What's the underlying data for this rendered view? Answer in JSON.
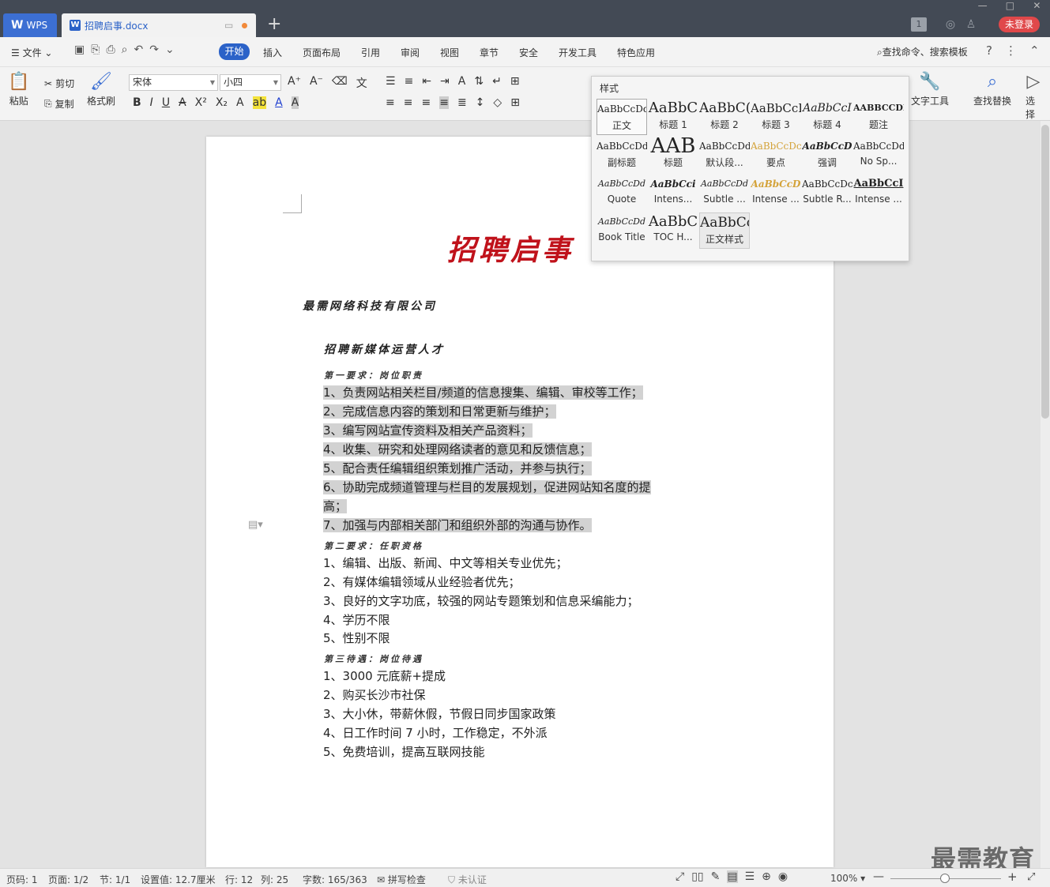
{
  "titlebar": {
    "app_tab": "WPS",
    "doc_tab": "招聘启事.docx",
    "new_tab": "+",
    "login": "未登录",
    "window_buttons": [
      "—",
      "□",
      "✕"
    ],
    "badge": "1"
  },
  "menubar": {
    "file": "文件",
    "items": [
      "开始",
      "插入",
      "页面布局",
      "引用",
      "审阅",
      "视图",
      "章节",
      "安全",
      "开发工具",
      "特色应用"
    ],
    "search": "查找命令、搜索模板"
  },
  "ribbon": {
    "paste": "粘贴",
    "cut": "剪切",
    "copy": "复制",
    "format_painter": "格式刷",
    "font_name": "宋体",
    "font_size": "小四",
    "text_tools": "文字工具",
    "find_replace": "查找替换",
    "select": "选择"
  },
  "style_popup": {
    "title": "样式",
    "styles": [
      {
        "preview": "AaBbCcDd",
        "name": "正文"
      },
      {
        "preview": "AaBbC",
        "name": "标题 1"
      },
      {
        "preview": "AaBbC(",
        "name": "标题 2"
      },
      {
        "preview": "AaBbCcI",
        "name": "标题 3"
      },
      {
        "preview": "AaBbCcI",
        "name": "标题 4"
      },
      {
        "preview": "AABBCCDD",
        "name": "题注"
      },
      {
        "preview": "AaBbCcDd",
        "name": "副标题"
      },
      {
        "preview": "AAB",
        "name": "标题"
      },
      {
        "preview": "AaBbCcDd",
        "name": "默认段..."
      },
      {
        "preview": "AaBbCcDc",
        "name": "要点"
      },
      {
        "preview": "AaBbCcD",
        "name": "强调"
      },
      {
        "preview": "AaBbCcDd",
        "name": "No Sp..."
      },
      {
        "preview": "AaBbCcDd",
        "name": "Quote"
      },
      {
        "preview": "AaBbCci",
        "name": "Intens..."
      },
      {
        "preview": "AaBbCcDd",
        "name": "Subtle ..."
      },
      {
        "preview": "AaBbCcD",
        "name": "Intense ..."
      },
      {
        "preview": "AaBbCcDc",
        "name": "Subtle R..."
      },
      {
        "preview": "AaBbCcI",
        "name": "Intense ..."
      },
      {
        "preview": "AaBbCcDd",
        "name": "Book Title"
      },
      {
        "preview": "AaBbC",
        "name": "TOC H..."
      },
      {
        "preview": "AaBbCc",
        "name": "正文样式"
      }
    ]
  },
  "document": {
    "title": "招聘启事",
    "company": "最需网络科技有限公司",
    "job_title": "招聘新媒体运营人才",
    "section1": "第一要求：岗位职责",
    "section1_items": [
      "1、负责网站相关栏目/频道的信息搜集、编辑、审校等工作；",
      "2、完成信息内容的策划和日常更新与维护；",
      "3、编写网站宣传资料及相关产品资料；",
      "4、收集、研究和处理网络读者的意见和反馈信息；",
      "5、配合责任编辑组织策划推广活动，并参与执行；",
      "6、协助完成频道管理与栏目的发展规划，促进网站知名度的提",
      "高；",
      "7、加强与内部相关部门和组织外部的沟通与协作。"
    ],
    "section2": "第二要求：任职资格",
    "section2_items": [
      "1、编辑、出版、新闻、中文等相关专业优先；",
      "2、有媒体编辑领域从业经验者优先；",
      "3、良好的文字功底，较强的网站专题策划和信息采编能力；",
      "4、学历不限",
      "5、性别不限"
    ],
    "section3": "第三待遇：岗位待遇",
    "section3_items": [
      "1、3000 元底薪+提成",
      "2、购买长沙市社保",
      "3、大小休，带薪休假，节假日同步国家政策",
      "4、日工作时间 7 小时，工作稳定，不外派",
      "5、免费培训，提高互联网技能"
    ]
  },
  "statusbar": {
    "page_num": "页码: 1",
    "pages": "页面: 1/2",
    "section": "节: 1/1",
    "setting": "设置值: 12.7厘米",
    "row": "行: 12",
    "col": "列: 25",
    "words": "字数: 165/363",
    "spell": "拼写检查",
    "cert": "未认证",
    "zoom": "100%"
  },
  "watermark": "最需教育"
}
